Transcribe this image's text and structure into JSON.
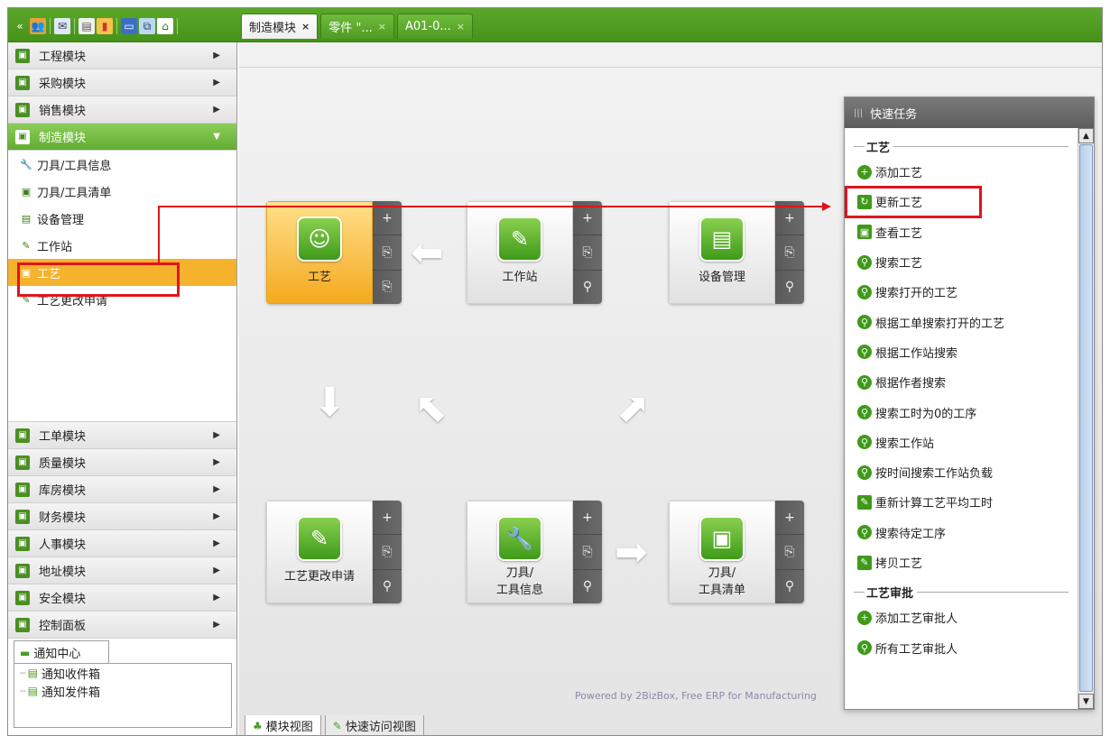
{
  "toolbar": {
    "icons": [
      "collapse-icon",
      "users-icon",
      "mail-icon",
      "document-icon",
      "chart-icon",
      "window-icon",
      "network-icon",
      "home-icon"
    ]
  },
  "tabs": [
    {
      "label": "制造模块",
      "close": "×",
      "active": true
    },
    {
      "label": "零件 \"...",
      "close": "×",
      "active": false
    },
    {
      "label": "A01-0...",
      "close": "×",
      "active": false
    }
  ],
  "sidebar": {
    "modules_top": [
      {
        "label": "工程模块"
      },
      {
        "label": "采购模块"
      },
      {
        "label": "销售模块"
      },
      {
        "label": "制造模块",
        "open": true
      }
    ],
    "submenu": [
      {
        "label": "刀具/工具信息"
      },
      {
        "label": "刀具/工具清单"
      },
      {
        "label": "设备管理"
      },
      {
        "label": "工作站"
      },
      {
        "label": "工艺",
        "selected": true
      },
      {
        "label": "工艺更改申请"
      }
    ],
    "modules_bottom": [
      {
        "label": "工单模块"
      },
      {
        "label": "质量模块"
      },
      {
        "label": "库房模块"
      },
      {
        "label": "财务模块"
      },
      {
        "label": "人事模块"
      },
      {
        "label": "地址模块"
      },
      {
        "label": "安全模块"
      },
      {
        "label": "控制面板"
      }
    ],
    "notify": {
      "tab": "通知中心",
      "items": [
        "通知收件箱",
        "通知发件箱"
      ]
    }
  },
  "main": {
    "tiles": [
      {
        "label": "工艺",
        "active": true
      },
      {
        "label": "工作站"
      },
      {
        "label": "设备管理"
      },
      {
        "label": "工艺更改申请"
      },
      {
        "label": "刀具/\n工具信息"
      },
      {
        "label": "刀具/\n工具清单"
      }
    ],
    "side_buttons": {
      "add": "+",
      "open": "⎘",
      "search": "⚲"
    },
    "powered": "Powered by 2BizBox, Free ERP for Manufacturing",
    "view_tabs": [
      "模块视图",
      "快速访问视图"
    ]
  },
  "quick_tasks": {
    "title": "快速任务",
    "sections": [
      {
        "title": "工艺",
        "items": [
          "添加工艺",
          "更新工艺",
          "查看工艺",
          "搜索工艺",
          "搜索打开的工艺",
          "根据工单搜索打开的工艺",
          "根据工作站搜索",
          "根据作者搜索",
          "搜索工时为0的工序",
          "搜索工作站",
          "按时间搜索工作站负载",
          "重新计算工艺平均工时",
          "搜索待定工序",
          "拷贝工艺"
        ]
      },
      {
        "title": "工艺审批",
        "items": [
          "添加工艺审批人",
          "所有工艺审批人"
        ]
      }
    ]
  },
  "colors": {
    "accent": "#4f9c23",
    "selected": "#f5b32d",
    "highlight": "#e0141c"
  }
}
